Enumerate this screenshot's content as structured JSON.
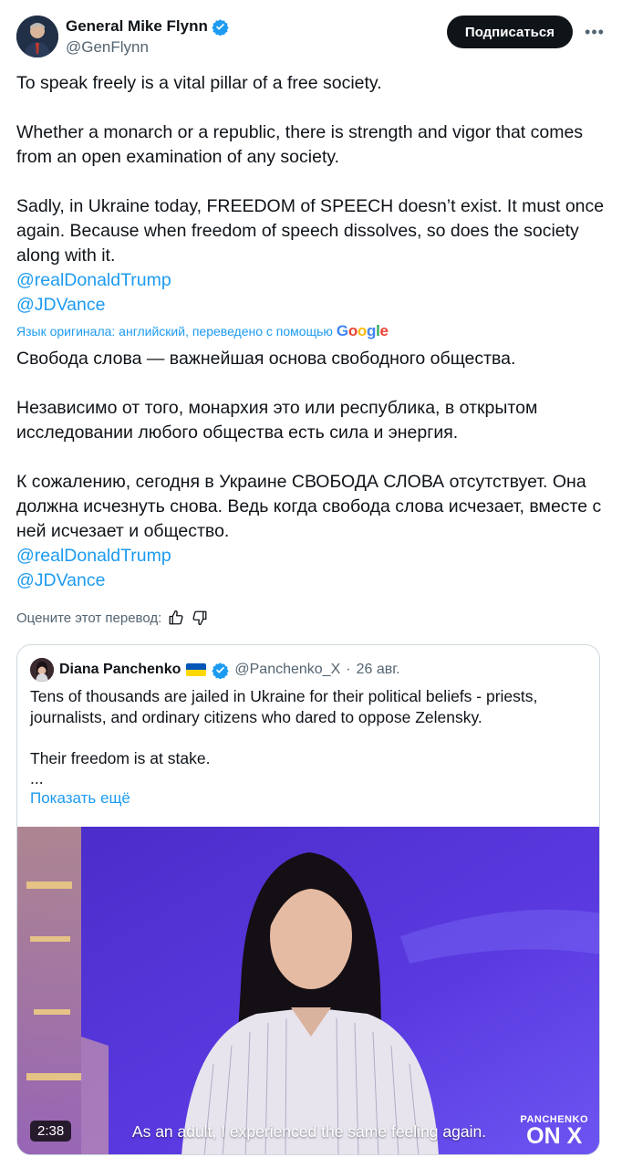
{
  "author": {
    "name": "General Mike Flynn",
    "handle": "@GenFlynn",
    "avatar_icon": "user-avatar-icon",
    "verified_color": "#1d9bf0"
  },
  "actions": {
    "subscribe_label": "Подписаться",
    "more_label": "•••"
  },
  "original": {
    "p1": "To speak freely is a vital pillar of a free society.",
    "p2": "Whether a monarch or a republic, there is strength and vigor that comes from an open examination of any society.",
    "p3": "Sadly, in Ukraine today, FREEDOM of SPEECH doesn’t exist. It must once again. Because when freedom of speech dissolves, so does the society along with it.",
    "mention1": "@realDonaldTrump",
    "mention2": "@JDVance"
  },
  "translation_note": "Язык оригинала: английский, переведено с помощью",
  "translation_provider": "Google",
  "translated": {
    "p1": "Свобода слова — важнейшая основа свободного общества.",
    "p2": "Независимо от того, монархия это или республика, в открытом исследовании любого общества есть сила и энергия.",
    "p3": "К сожалению, сегодня в Украине СВОБОДА СЛОВА отсутствует. Она должна исчезнуть снова. Ведь когда свобода слова исчезает, вместе с ней исчезает и общество.",
    "mention1": "@realDonaldTrump",
    "mention2": "@JDVance"
  },
  "rate": {
    "label": "Оцените этот перевод:",
    "thumb_up_icon": "thumbs-up-icon",
    "thumb_down_icon": "thumbs-down-icon"
  },
  "quote": {
    "name": "Diana Panchenko",
    "handle": "@Panchenko_X",
    "separator": "·",
    "date": "26 авг.",
    "text1": "Tens of thousands are jailed in Ukraine for their political beliefs - priests, journalists, and ordinary citizens who dared to oppose Zelensky.",
    "text2": "Their freedom is at stake.",
    "ellipsis": "...",
    "show_more": "Показать ещё",
    "video": {
      "duration": "2:38",
      "subtitle": "As an adult, I experienced the same feeling again.",
      "brand_top": "PANCHENKO",
      "brand_bottom": "ON X"
    }
  }
}
